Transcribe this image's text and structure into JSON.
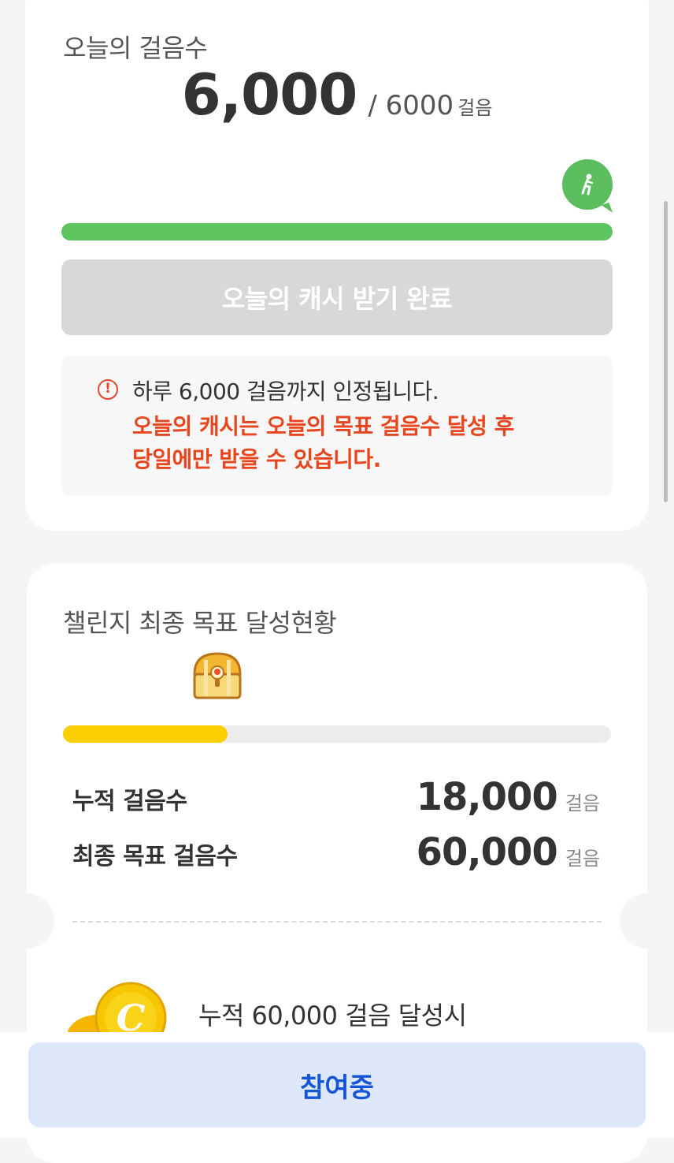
{
  "today": {
    "title": "오늘의 걸음수",
    "current_steps": "6,000",
    "goal_steps": "/ 6000",
    "unit": "걸음",
    "progress": 1.0,
    "cash_button_label": "오늘의 캐시 받기 완료",
    "notice": {
      "icon": "exclamation-circle-icon",
      "line1": "하루 6,000 걸음까지 인정됩니다.",
      "line2": "오늘의 캐시는 오늘의 목표 걸음수 달성 후",
      "line3": "당일에만 받을 수 있습니다."
    }
  },
  "challenge": {
    "title": "챌린지 최종 목표 달성현황",
    "progress": 0.3,
    "stats": [
      {
        "label": "누적 걸음수",
        "value": "18,000",
        "unit": "걸음"
      },
      {
        "label": "최종 목표 걸음수",
        "value": "60,000",
        "unit": "걸음"
      }
    ],
    "reward_text": "누적 60,000 걸음 달성시"
  },
  "join_button_label": "참여중",
  "colors": {
    "green": "#5ec460",
    "yellow": "#fccf00",
    "alert_red": "#e8451e",
    "primary_blue": "#1556d6",
    "button_bg_blue": "#dfe8fb"
  }
}
